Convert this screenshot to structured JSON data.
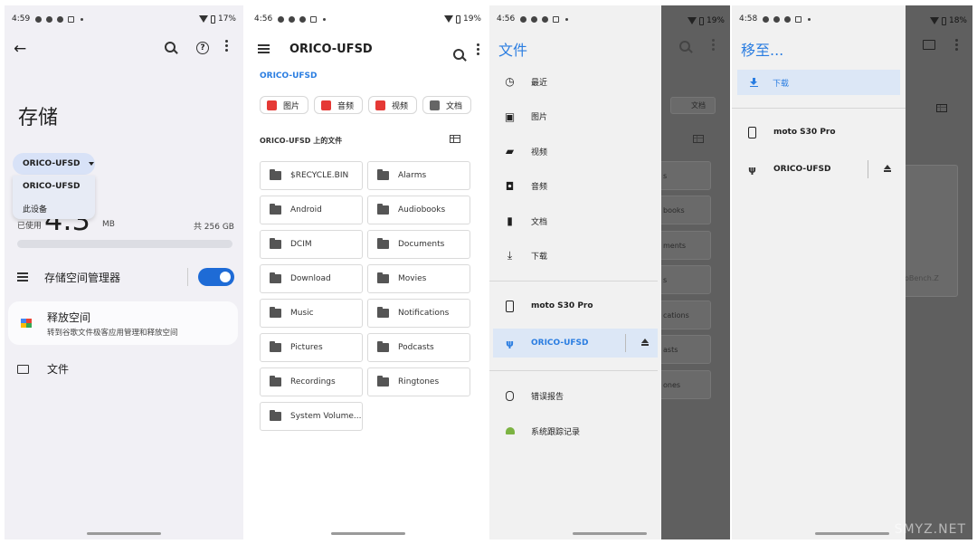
{
  "colors": {
    "accent": "#2a7de1",
    "toggle": "#1e6bd6",
    "selected_bg": "#dce7f6"
  },
  "panel1": {
    "status": {
      "time": "4:59",
      "battery": "17%"
    },
    "title": "存储",
    "dropdown": {
      "selected": "ORICO-UFSD",
      "options": [
        "ORICO-UFSD",
        "此设备"
      ]
    },
    "used_label": "已使用",
    "used_value": "4.3",
    "used_unit": "MB",
    "total": "共 256 GB",
    "usage_fraction": 0.0,
    "storage_manager": {
      "label": "存储空间管理器",
      "enabled": true
    },
    "free_up": {
      "title": "释放空间",
      "subtitle": "转到谷歌文件极客应用管理和释放空间"
    },
    "files_label": "文件"
  },
  "panel2": {
    "status": {
      "time": "4:56",
      "battery": "19%"
    },
    "title": "ORICO-UFSD",
    "breadcrumb": "ORICO-UFSD",
    "chips": [
      {
        "label": "图片",
        "icon": "image-icon",
        "color": "#e53935"
      },
      {
        "label": "音频",
        "icon": "audio-icon",
        "color": "#e53935"
      },
      {
        "label": "视频",
        "icon": "video-icon",
        "color": "#e53935"
      },
      {
        "label": "文档",
        "icon": "document-icon",
        "color": "#666666"
      }
    ],
    "section": "ORICO-UFSD 上的文件",
    "folders": [
      "$RECYCLE.BIN",
      "Alarms",
      "Android",
      "Audiobooks",
      "DCIM",
      "Documents",
      "Download",
      "Movies",
      "Music",
      "Notifications",
      "Pictures",
      "Podcasts",
      "Recordings",
      "Ringtones",
      "System Volume..."
    ]
  },
  "panel3": {
    "status": {
      "time": "4:56",
      "battery": "19%"
    },
    "title": "文件",
    "items": [
      {
        "label": "最近",
        "icon": "clock-icon"
      },
      {
        "label": "图片",
        "icon": "image-icon"
      },
      {
        "label": "视频",
        "icon": "video-icon"
      },
      {
        "label": "音频",
        "icon": "audio-icon"
      },
      {
        "label": "文档",
        "icon": "document-icon"
      },
      {
        "label": "下载",
        "icon": "download-icon"
      }
    ],
    "devices": [
      {
        "label": "moto S30 Pro",
        "icon": "phone-icon"
      },
      {
        "label": "ORICO-UFSD",
        "icon": "usb-icon"
      }
    ],
    "extras": [
      {
        "label": "错误报告",
        "icon": "bug-icon"
      },
      {
        "label": "系统跟踪记录",
        "icon": "android-icon"
      }
    ],
    "ghost": {
      "doc_chip": "文档",
      "rows": [
        "s",
        "books",
        "ments",
        "s",
        "cations",
        "asts",
        "ones"
      ]
    }
  },
  "panel4": {
    "status": {
      "time": "4:58",
      "battery": "18%"
    },
    "title": "移至...",
    "download": "下载",
    "devices": [
      {
        "label": "moto S30 Pro",
        "icon": "phone-icon"
      },
      {
        "label": "ORICO-UFSD",
        "icon": "usb-icon"
      }
    ],
    "ghost_file": "oBench.Z"
  },
  "watermark": "SMYZ.NET"
}
